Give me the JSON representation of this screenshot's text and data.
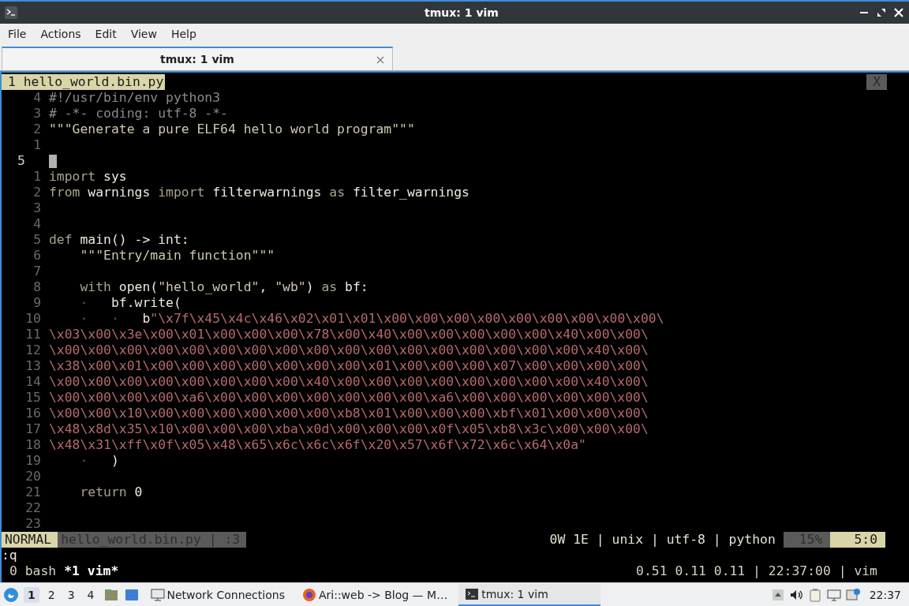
{
  "window": {
    "title": "tmux: 1 vim"
  },
  "menu": [
    "File",
    "Actions",
    "Edit",
    "View",
    "Help"
  ],
  "tabs": [
    {
      "label": "tmux: 1 vim",
      "selected": true
    }
  ],
  "vim": {
    "buffer_tab": "1 hello_world.bin.py",
    "close_label": "X",
    "lines": [
      {
        "number": "4",
        "current": false,
        "segments": [
          {
            "kind": "comment",
            "text": "#!/usr/bin/env python3"
          }
        ]
      },
      {
        "number": "3",
        "current": false,
        "segments": [
          {
            "kind": "comment",
            "text": "# -*- coding: utf-8 -*-"
          }
        ]
      },
      {
        "number": "2",
        "current": false,
        "segments": [
          {
            "kind": "string",
            "text": "\"\"\"Generate a pure ELF64 hello world program\"\"\""
          }
        ]
      },
      {
        "number": "1",
        "current": false
      },
      {
        "number": "5",
        "current": true
      },
      {
        "number": "1",
        "current": false,
        "segments": [
          {
            "kind": "keyword",
            "text": "import"
          },
          {
            "kind": "plain",
            "text": " sys"
          }
        ]
      },
      {
        "number": "2",
        "current": false,
        "segments": [
          {
            "kind": "keyword",
            "text": "from"
          },
          {
            "kind": "plain",
            "text": " warnings "
          },
          {
            "kind": "keyword",
            "text": "import"
          },
          {
            "kind": "plain",
            "text": " filterwarnings "
          },
          {
            "kind": "keyword",
            "text": "as"
          },
          {
            "kind": "plain",
            "text": " filter_warnings"
          }
        ]
      },
      {
        "number": "3",
        "current": false
      },
      {
        "number": "4",
        "current": false
      },
      {
        "number": "5",
        "current": false,
        "segments": [
          {
            "kind": "keyword",
            "text": "def"
          },
          {
            "kind": "plain",
            "text": " main() -> int:"
          }
        ]
      },
      {
        "number": "6",
        "current": false,
        "segments": [
          {
            "kind": "string",
            "text": "    \"\"\"Entry/main function\"\"\""
          }
        ]
      },
      {
        "number": "7",
        "current": false
      },
      {
        "number": "8",
        "current": false,
        "segments": [
          {
            "kind": "keyword",
            "text": "    with"
          },
          {
            "kind": "plain",
            "text": " open("
          },
          {
            "kind": "string",
            "text": "\"hello_world\""
          },
          {
            "kind": "plain",
            "text": ", "
          },
          {
            "kind": "string",
            "text": "\"wb\""
          },
          {
            "kind": "plain",
            "text": ") "
          },
          {
            "kind": "keyword",
            "text": "as"
          },
          {
            "kind": "plain",
            "text": " bf:"
          }
        ]
      },
      {
        "number": "9",
        "current": false,
        "segments": [
          {
            "kind": "whitespace",
            "text": "    ·   "
          },
          {
            "kind": "plain",
            "text": "bf.write("
          }
        ]
      },
      {
        "number": "10",
        "current": false,
        "segments": [
          {
            "kind": "whitespace",
            "text": "    ·   ·   "
          },
          {
            "kind": "plain",
            "text": "b"
          },
          {
            "kind": "bytes",
            "text": "\"\\x7f\\x45\\x4c\\x46\\x02\\x01\\x01\\x00\\x00\\x00\\x00\\x00\\x00\\x00\\x00\\x00\\"
          }
        ]
      },
      {
        "number": "11",
        "current": false,
        "segments": [
          {
            "kind": "bytes",
            "text": "\\x03\\x00\\x3e\\x00\\x01\\x00\\x00\\x00\\x78\\x00\\x40\\x00\\x00\\x00\\x00\\x00\\x40\\x00\\x00\\"
          }
        ]
      },
      {
        "number": "12",
        "current": false,
        "segments": [
          {
            "kind": "bytes",
            "text": "\\x00\\x00\\x00\\x00\\x00\\x00\\x00\\x00\\x00\\x00\\x00\\x00\\x00\\x00\\x00\\x00\\x00\\x40\\x00\\"
          }
        ]
      },
      {
        "number": "13",
        "current": false,
        "segments": [
          {
            "kind": "bytes",
            "text": "\\x38\\x00\\x01\\x00\\x00\\x00\\x00\\x00\\x00\\x00\\x01\\x00\\x00\\x00\\x07\\x00\\x00\\x00\\x00\\"
          }
        ]
      },
      {
        "number": "14",
        "current": false,
        "segments": [
          {
            "kind": "bytes",
            "text": "\\x00\\x00\\x00\\x00\\x00\\x00\\x00\\x00\\x40\\x00\\x00\\x00\\x00\\x00\\x00\\x00\\x00\\x40\\x00\\"
          }
        ]
      },
      {
        "number": "15",
        "current": false,
        "segments": [
          {
            "kind": "bytes",
            "text": "\\x00\\x00\\x00\\x00\\xa6\\x00\\x00\\x00\\x00\\x00\\x00\\x00\\xa6\\x00\\x00\\x00\\x00\\x00\\x00\\"
          }
        ]
      },
      {
        "number": "16",
        "current": false,
        "segments": [
          {
            "kind": "bytes",
            "text": "\\x00\\x00\\x10\\x00\\x00\\x00\\x00\\x00\\x00\\xb8\\x01\\x00\\x00\\x00\\xbf\\x01\\x00\\x00\\x00\\"
          }
        ]
      },
      {
        "number": "17",
        "current": false,
        "segments": [
          {
            "kind": "bytes",
            "text": "\\x48\\x8d\\x35\\x10\\x00\\x00\\x00\\xba\\x0d\\x00\\x00\\x00\\x0f\\x05\\xb8\\x3c\\x00\\x00\\x00\\"
          }
        ]
      },
      {
        "number": "18",
        "current": false,
        "segments": [
          {
            "kind": "bytes",
            "text": "\\x48\\x31\\xff\\x0f\\x05\\x48\\x65\\x6c\\x6c\\x6f\\x20\\x57\\x6f\\x72\\x6c\\x64\\x0a\""
          }
        ]
      },
      {
        "number": "19",
        "current": false,
        "segments": [
          {
            "kind": "whitespace",
            "text": "    ·   "
          },
          {
            "kind": "plain",
            "text": ")"
          }
        ]
      },
      {
        "number": "20",
        "current": false
      },
      {
        "number": "21",
        "current": false,
        "segments": [
          {
            "kind": "keyword",
            "text": "    return"
          },
          {
            "kind": "plain",
            "text": " 0"
          }
        ]
      },
      {
        "number": "22",
        "current": false
      },
      {
        "number": "23",
        "current": false
      }
    ],
    "statusline": {
      "mode": "NORMAL",
      "file": "hello_world.bin.py | :3",
      "info": "0W 1E | unix | utf-8 | python",
      "percent": "15%",
      "position": "5:0"
    },
    "command": ":q"
  },
  "tmux": {
    "windows": [
      {
        "label": "0 bash",
        "selected": false
      },
      {
        "label": "*1 vim*",
        "selected": true
      }
    ],
    "status": "0.51 0.11 0.11 | 22:37:00 | vim"
  },
  "taskbar": {
    "workspaces": [
      {
        "label": "1",
        "selected": true
      },
      {
        "label": "2",
        "selected": false
      },
      {
        "label": "3",
        "selected": false
      },
      {
        "label": "4",
        "selected": false
      }
    ],
    "tasks": [
      {
        "kind": "network",
        "label": "Network Connections",
        "selected": false
      },
      {
        "kind": "browser",
        "label": "Ari::web -> Blog — M…",
        "selected": false
      },
      {
        "kind": "terminal",
        "label": "tmux: 1 vim",
        "selected": true
      }
    ],
    "clock": "22:37"
  }
}
